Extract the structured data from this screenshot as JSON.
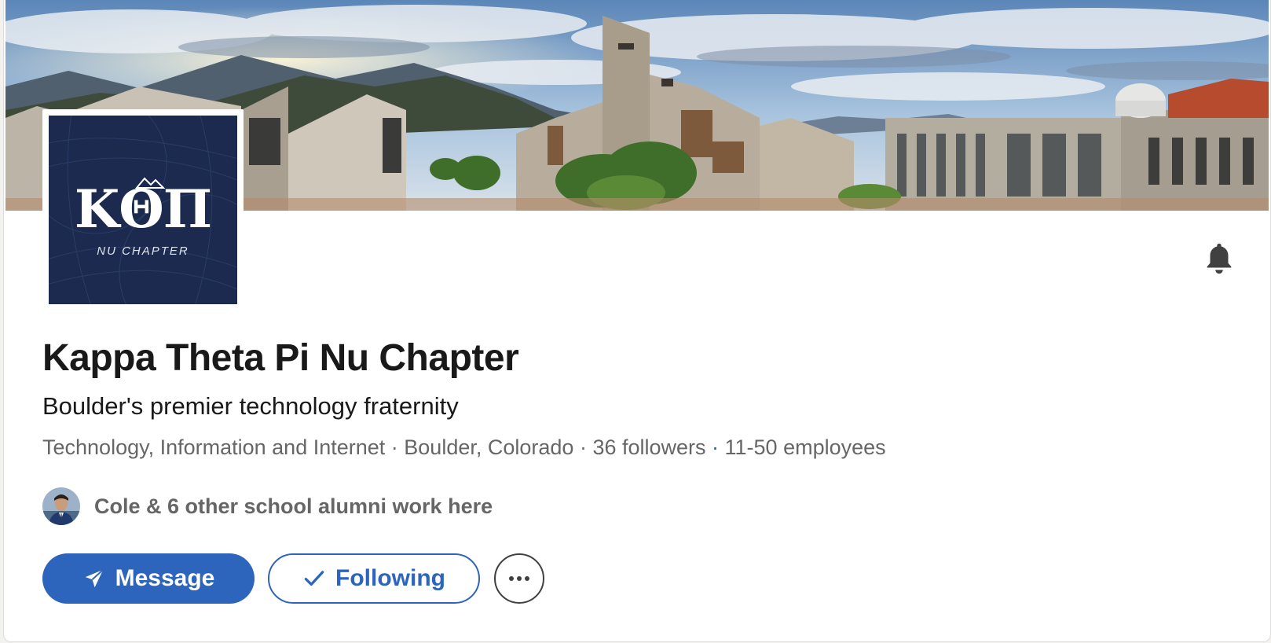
{
  "company": {
    "name": "Kappa Theta Pi Nu Chapter",
    "tagline": "Boulder's premier technology fraternity",
    "industry": "Technology, Information and Internet",
    "location": "Boulder, Colorado",
    "followers": "36 followers",
    "employees": "11-50 employees"
  },
  "logo": {
    "letters": "ΚΘΠ",
    "subtitle": "NU CHAPTER",
    "background_color": "#1b2a4e"
  },
  "alumni": {
    "text": "Cole & 6 other school alumni work here"
  },
  "actions": {
    "message_label": "Message",
    "following_label": "Following",
    "more_icon": "ellipsis-icon",
    "bell_icon": "bell-icon"
  },
  "colors": {
    "accent": "#2d64bc",
    "text_primary": "#191919",
    "text_secondary": "#666666"
  },
  "separators": {
    "dot": " · "
  }
}
